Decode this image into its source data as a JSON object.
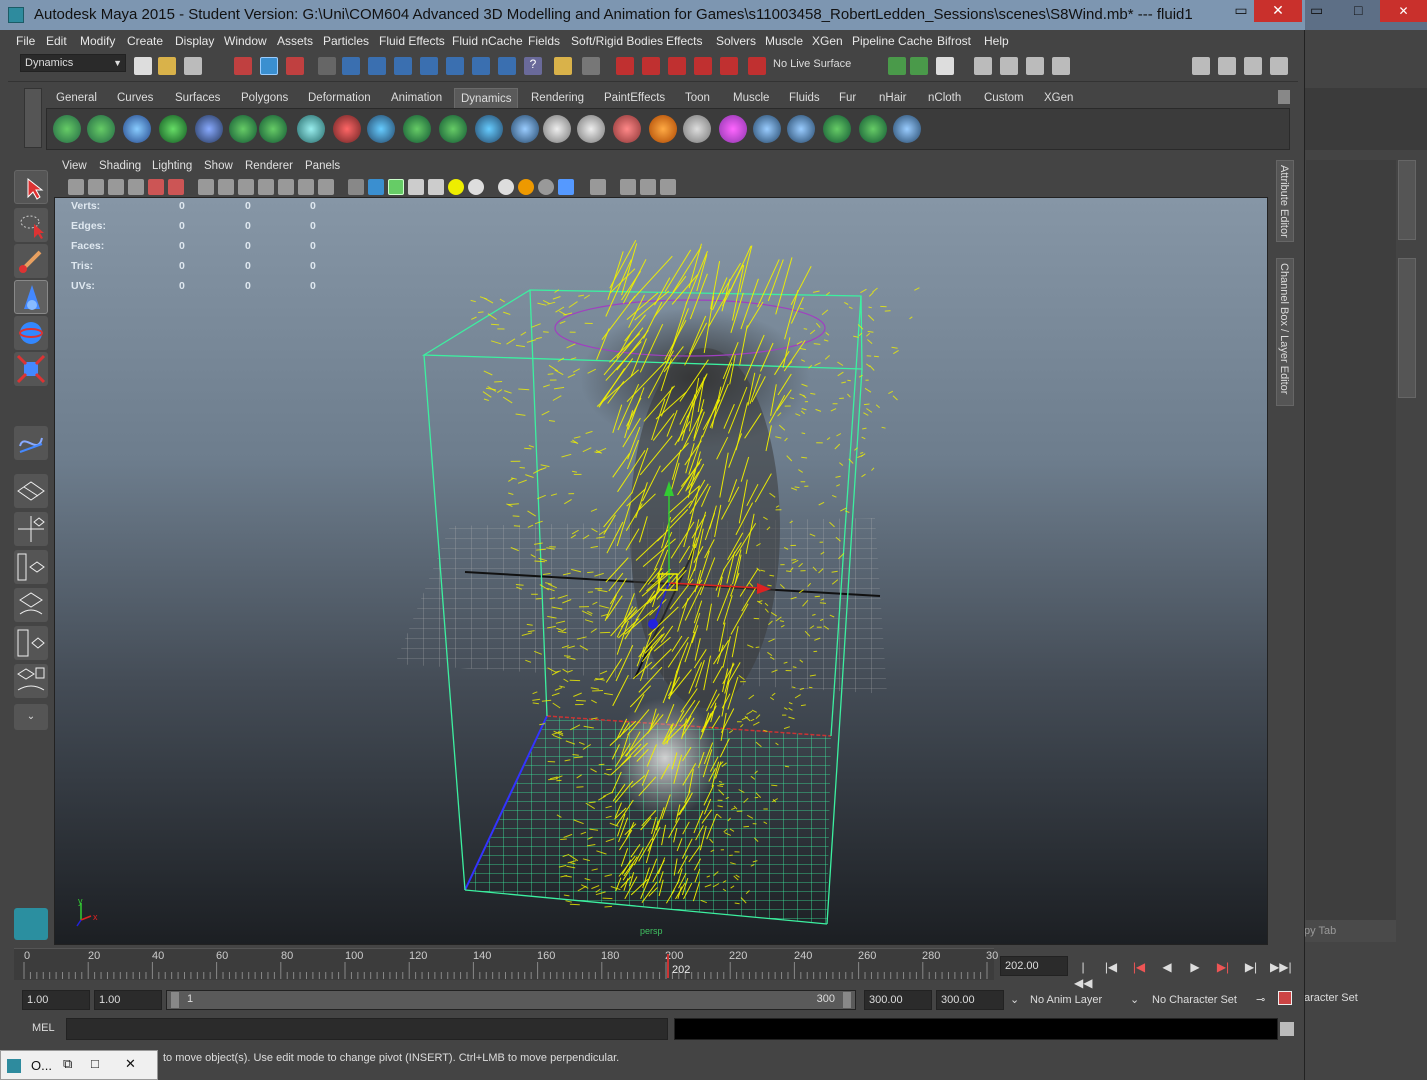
{
  "window": {
    "title": "Autodesk Maya 2015 - Student Version: G:\\Uni\\COM604 Advanced 3D Modelling and Animation for Games\\s11003458_RobertLedden_Sessions\\scenes\\S8Wind.mb*   ---   fluid1",
    "minimize": "▭",
    "maximize": "□",
    "close": "✕"
  },
  "menubar": [
    "File",
    "Edit",
    "Modify",
    "Create",
    "Display",
    "Window",
    "Assets",
    "Particles",
    "Fluid Effects",
    "Fluid nCache",
    "Fields",
    "Soft/Rigid Bodies",
    "Effects",
    "Solvers",
    "Muscle",
    "XGen",
    "Pipeline Cache",
    "Bifrost",
    "Help"
  ],
  "status": {
    "menuset": "Dynamics",
    "live_surface": "No Live Surface"
  },
  "shelf_tabs": [
    "General",
    "Curves",
    "Surfaces",
    "Polygons",
    "Deformation",
    "Animation",
    "Dynamics",
    "Rendering",
    "PaintEffects",
    "Toon",
    "Muscle",
    "Fluids",
    "Fur",
    "nHair",
    "nCloth",
    "Custom",
    "XGen"
  ],
  "active_shelf": "Dynamics",
  "panel_menu": [
    "View",
    "Shading",
    "Lighting",
    "Show",
    "Renderer",
    "Panels"
  ],
  "hud": {
    "rows": [
      {
        "label": "Verts:",
        "v1": "0",
        "v2": "0",
        "v3": "0"
      },
      {
        "label": "Edges:",
        "v1": "0",
        "v2": "0",
        "v3": "0"
      },
      {
        "label": "Faces:",
        "v1": "0",
        "v2": "0",
        "v3": "0"
      },
      {
        "label": "Tris:",
        "v1": "0",
        "v2": "0",
        "v3": "0"
      },
      {
        "label": "UVs:",
        "v1": "0",
        "v2": "0",
        "v3": "0"
      }
    ],
    "camera": "persp",
    "axis_y": "y",
    "axis_x": "x"
  },
  "right_tabs": [
    "Attribute Editor",
    "Channel Box / Layer Editor"
  ],
  "timeline": {
    "ticks": [
      "0",
      "20",
      "40",
      "60",
      "80",
      "100",
      "120",
      "140",
      "160",
      "180",
      "200",
      "220",
      "240",
      "260",
      "280",
      "30"
    ],
    "current_marker": "202",
    "current_frame": "202.00"
  },
  "range": {
    "start": "1.00",
    "anim_start": "1.00",
    "slider_start": "1",
    "slider_end": "300",
    "anim_end": "300.00",
    "end": "300.00",
    "anim_layer": "No Anim Layer",
    "character_set": "No Character Set"
  },
  "background_window": {
    "character_set": "aracter Set",
    "copy_tab": "py Tab"
  },
  "cmdline": {
    "label": "MEL"
  },
  "helpline": "to move object(s). Use edit mode to change pivot (INSERT). Ctrl+LMB to move perpendicular.",
  "taskbar": {
    "label": "O..."
  },
  "colors": {
    "title_bg": "#7d96b1",
    "wireframe": "#3cf0a0",
    "vectors": "#f0f000"
  }
}
